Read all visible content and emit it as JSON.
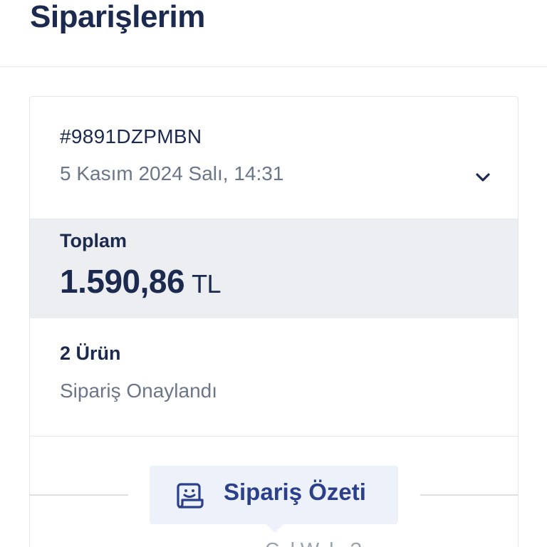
{
  "header": {
    "title": "Siparişlerim"
  },
  "order": {
    "number": "#9891DZPMBN",
    "date": "5 Kasım 2024 Salı, 14:31",
    "total_label": "Toplam",
    "total_amount": "1.590,86",
    "total_currency": "TL",
    "item_count": "2 Ürün",
    "status": "Sipariş Onaylandı"
  },
  "summary": {
    "button_label": "Sipariş Özeti",
    "icon": "receipt-smile-icon"
  },
  "below_fold_text": "Ç..l W..l.. ?",
  "icons": {
    "expand": "chevron-down-icon"
  },
  "colors": {
    "primary_text": "#1b2a4e",
    "secondary_text": "#6b7689",
    "accent": "#2b3f8a",
    "total_bg": "#eceef1",
    "summary_bg": "#edf2fa"
  }
}
